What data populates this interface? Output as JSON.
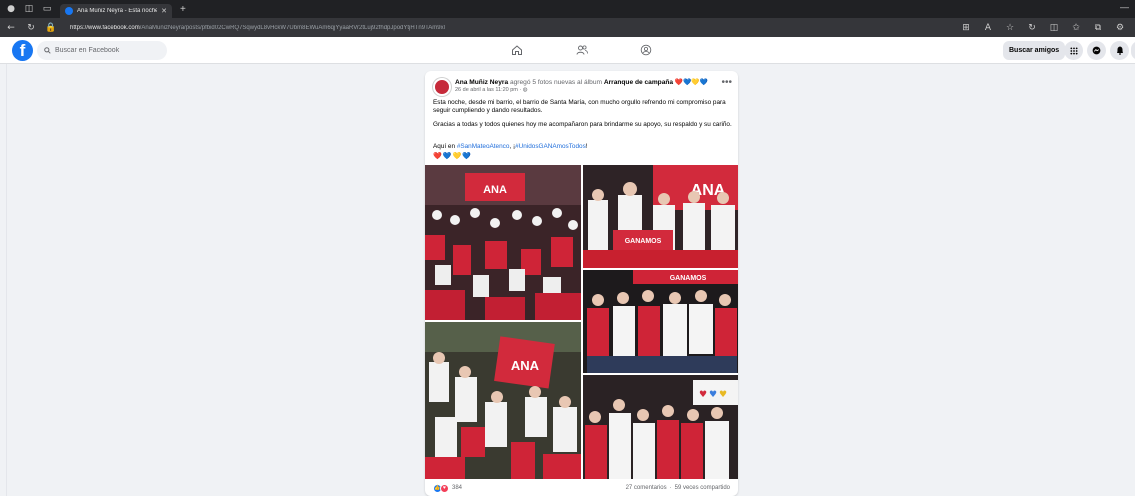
{
  "browser": {
    "tab_title": "Ana Muñiz Neyra - Esta noche, d",
    "url_domain": "https://www.facebook.com",
    "url_path": "/AnaMunizNeyra/posts/pfbid02CwRQ7SqwydL8vHckW7Ubm8EWuAm6qjYyaaRVr2tLuj92fhdpJpodYtjHTn9TAm9xl"
  },
  "facebook": {
    "search_placeholder": "Buscar en Facebook",
    "find_friends_label": "Buscar amigos",
    "brand_color": "#1877f2"
  },
  "post": {
    "author": "Ana Muñiz Neyra",
    "action": " agregó 5 fotos nuevas al álbum ",
    "album": "Arranque de campaña",
    "album_hearts": [
      "❤️",
      "💙",
      "💛",
      "💙"
    ],
    "date": "26 de abril a las 11:20 pm",
    "paragraph1": "Esta noche, desde mi barrio, el barrio de Santa María, con mucho orgullo refrendo mi compromiso para seguir cumpliendo y dando resultados.",
    "paragraph2": "Gracias a todas y todos quienes hoy me acompañaron para brindarme su apoyo, su respaldo y su cariño.",
    "hashtags_prefix": "Aquí en ",
    "hashtag1": "#SanMateoAtenco",
    "hashtags_sep": ", ¡",
    "hashtag2": "#UnidosGANAmosTodos",
    "hashtags_suffix": "!",
    "hearts": [
      "❤️",
      "💙",
      "💛",
      "💙"
    ],
    "photo_banner_text": "ANA",
    "photo_banner_small": "GANAMOS",
    "reaction_count": "384",
    "comments": "27 comentarios",
    "shares": "59 veces compartido"
  }
}
